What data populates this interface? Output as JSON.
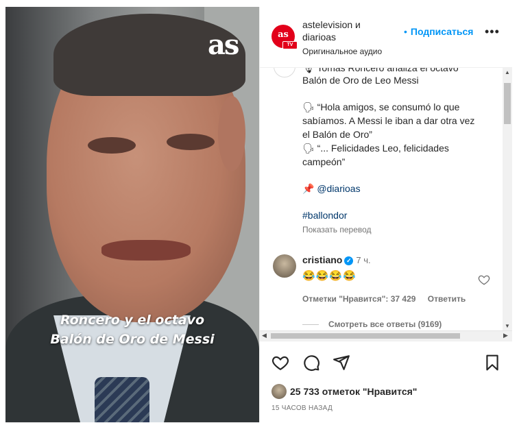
{
  "video": {
    "logo": "as",
    "caption_line1": "Roncero y el octavo",
    "caption_line2": "Balón de Oro de Messi"
  },
  "header": {
    "avatar_text": "as",
    "avatar_badge": "TV",
    "username": "astelevision",
    "conjunction": "и",
    "coauthor": "diarioas",
    "audio": "Оригинальное аудио",
    "follow_label": "Подписаться",
    "more_label": "•••"
  },
  "caption": {
    "cut_line": "🎙 Tomás Roncero analiza el octavo",
    "lines": [
      "Balón de Oro de Leo Messi",
      "🗣 “Hola amigos, se consumó lo que",
      "sabíamos. A Messi le iban a dar otra vez",
      "el Balón de Oro”",
      "🗣 “... Felicidades Leo, felicidades",
      "campeón”"
    ],
    "mention_pin": "📌",
    "mention": "@diarioas",
    "hashtag": "#ballondor",
    "translate_label": "Показать перевод"
  },
  "comment": {
    "username": "cristiano",
    "verified_mark": "✓",
    "time": "7 ч.",
    "text": "😂😂😂😂",
    "likes": "Отметки \"Нравится\": 37 429",
    "reply_label": "Ответить",
    "view_replies": "Смотреть все ответы (9169)"
  },
  "scrollbar": {
    "up": "▲",
    "down": "▼",
    "left": "◀",
    "right": "▶"
  },
  "footer": {
    "likes_count": "25 733 отметок \"Нравится\"",
    "time_ago": "15 ЧАСОВ НАЗАД"
  },
  "colors": {
    "accent": "#0095f6",
    "brand": "#e2001a",
    "text": "#262626",
    "muted": "#737373",
    "link": "#00376b"
  }
}
